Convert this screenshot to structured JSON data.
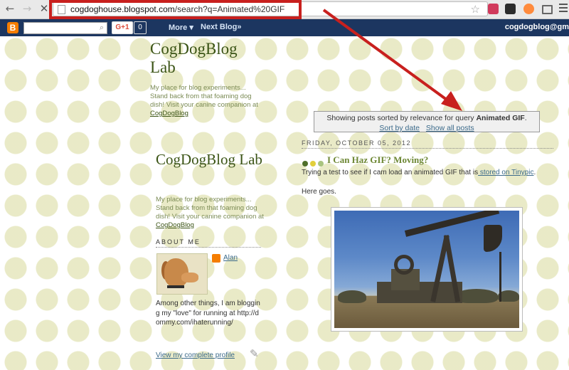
{
  "browser": {
    "url_domain": "cogdoghouse.blogspot.com",
    "url_path": "/search?q=Animated%20GIF",
    "icons": [
      "back-icon",
      "forward-icon",
      "stop-icon",
      "page-icon",
      "bookmark-star-icon",
      "menu-icon"
    ]
  },
  "navbar": {
    "logo_letter": "B",
    "gplus_label": "G+1",
    "gplus_count": "0",
    "more_label": "More ▾",
    "next_blog_label": "Next Blog»",
    "user_email": "cogdogblog@gm"
  },
  "header": {
    "title": "CogDogBlog Lab",
    "description_prefix": "My place for blog experiments... Stand back from that foaming dog dish! Visit your canine companion at ",
    "description_link": "CogDogBlog"
  },
  "sidebar": {
    "title": "CogDogBlog Lab",
    "description_prefix": "My place for blog experiments... Stand back from that foaming dog dish! Visit your canine companion at ",
    "description_link": "CogDogBlog",
    "about_heading": "ABOUT ME",
    "author_name": "Alan",
    "about_text": "Among other things, I am blogging my \"love\" for running at http://dommy.com/ihaterunning/",
    "view_profile": "View my complete profile"
  },
  "search_status": {
    "prefix": "Showing posts sorted by relevance for query ",
    "query": "Animated GIF",
    "suffix": ".",
    "sort_by_date": "Sort by date",
    "show_all": "Show all posts"
  },
  "post": {
    "date": "FRIDAY, OCTOBER 05, 2012",
    "title": "I Can Haz GIF? Moving?",
    "body_prefix": "Trying a test to see if I cam load an animated GIF that is",
    "body_link": " stored on Tinypic",
    "body_suffix": ".",
    "body_line2": "Here goes.",
    "dot_colors": [
      "#4f6f2a",
      "#e2cf3a",
      "#a9c47f"
    ]
  },
  "colors": {
    "accent_highlight": "#c8201e",
    "navbar_bg": "#1c3660",
    "title_green": "#3b5416"
  }
}
